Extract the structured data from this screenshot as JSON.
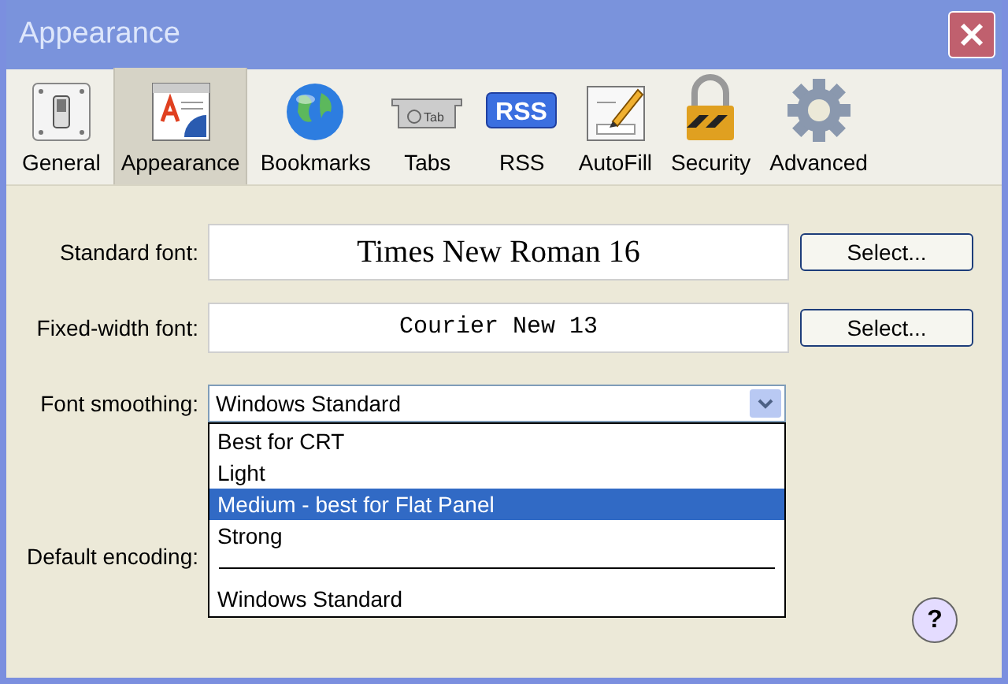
{
  "window": {
    "title": "Appearance"
  },
  "toolbar": [
    {
      "label": "General",
      "selected": false
    },
    {
      "label": "Appearance",
      "selected": true
    },
    {
      "label": "Bookmarks",
      "selected": false
    },
    {
      "label": "Tabs",
      "selected": false
    },
    {
      "label": "RSS",
      "selected": false
    },
    {
      "label": "AutoFill",
      "selected": false
    },
    {
      "label": "Security",
      "selected": false
    },
    {
      "label": "Advanced",
      "selected": false
    }
  ],
  "tabs_icon_text": "Tab",
  "rss_icon_text": "RSS",
  "standard_font": {
    "label": "Standard font:",
    "value": "Times New Roman 16",
    "button": "Select..."
  },
  "fixed_width_font": {
    "label": "Fixed-width font:",
    "value": "Courier New 13",
    "button": "Select..."
  },
  "font_smoothing": {
    "label": "Font smoothing:",
    "value": "Windows Standard",
    "expanded": true,
    "options": [
      {
        "kind": "option",
        "label": "Best for CRT",
        "highlighted": false
      },
      {
        "kind": "option",
        "label": "Light",
        "highlighted": false
      },
      {
        "kind": "option",
        "label": "Medium - best for Flat Panel",
        "highlighted": true
      },
      {
        "kind": "option",
        "label": "Strong",
        "highlighted": false
      },
      {
        "kind": "separator"
      },
      {
        "kind": "option",
        "label": "Windows Standard",
        "highlighted": false
      }
    ]
  },
  "default_encoding": {
    "label": "Default encoding:"
  },
  "help_button": "?"
}
